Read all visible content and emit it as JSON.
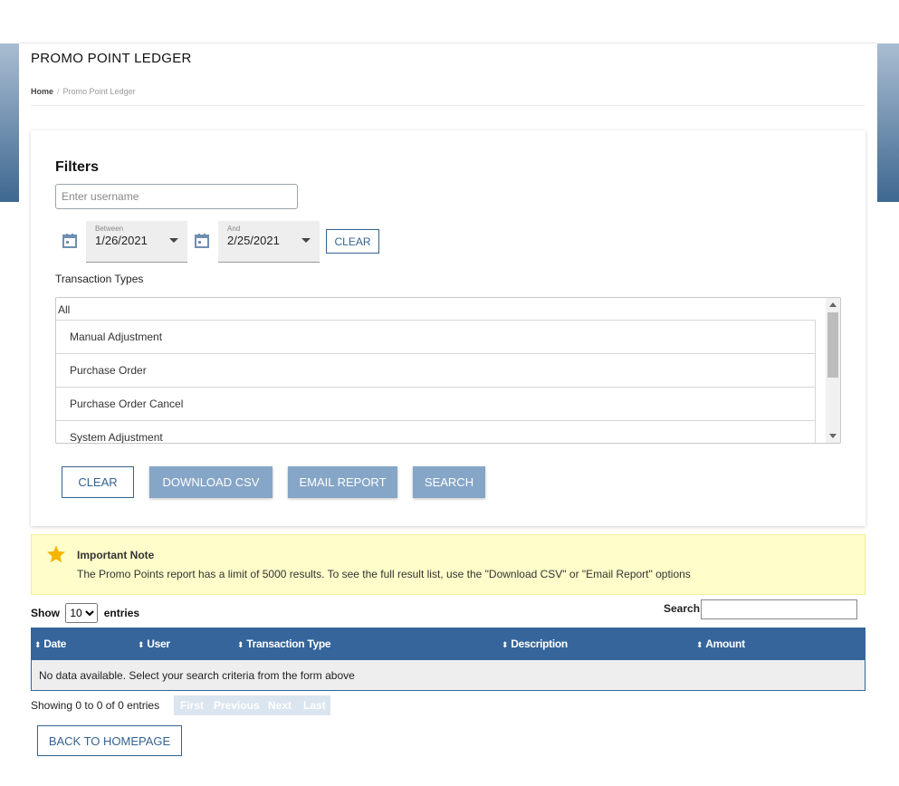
{
  "page": {
    "title": "PROMO POINT LEDGER",
    "breadcrumb": {
      "home": "Home",
      "separator": "/",
      "current": "Promo Point Ledger"
    }
  },
  "filters": {
    "heading": "Filters",
    "username_placeholder": "Enter username",
    "between_label": "Between",
    "between_value": "1/26/2021",
    "and_label": "And",
    "and_value": "2/25/2021",
    "date_clear_label": "CLEAR",
    "transaction_types_label": "Transaction Types",
    "transaction_types_all": "All",
    "transaction_types": [
      "Manual Adjustment",
      "Purchase Order",
      "Purchase Order Cancel",
      "System Adjustment"
    ],
    "actions": {
      "clear": "CLEAR",
      "download_csv": "DOWNLOAD CSV",
      "email_report": "EMAIL REPORT",
      "search": "SEARCH"
    }
  },
  "note": {
    "title": "Important Note",
    "body": "The Promo Points report has a limit of 5000 results. To see the full result list, use the \"Download CSV\" or \"Email Report\" options",
    "icon": "star-icon"
  },
  "table": {
    "show_label": "Show",
    "entries_value": "10",
    "entries_label": "entries",
    "search_label": "Search:",
    "columns": [
      "Date",
      "User",
      "Transaction Type",
      "Description",
      "Amount"
    ],
    "empty_message": "No data available. Select your search criteria from the form above",
    "info": "Showing 0 to 0 of 0 entries",
    "pagination": {
      "first": "First",
      "previous": "Previous",
      "next": "Next",
      "last": "Last"
    }
  },
  "footer": {
    "back_label": "BACK TO HOMEPAGE"
  },
  "colors": {
    "primary": "#35659a",
    "button_fill": "#86a6c7",
    "note_bg": "#fffdc9",
    "star": "#f5b400"
  }
}
